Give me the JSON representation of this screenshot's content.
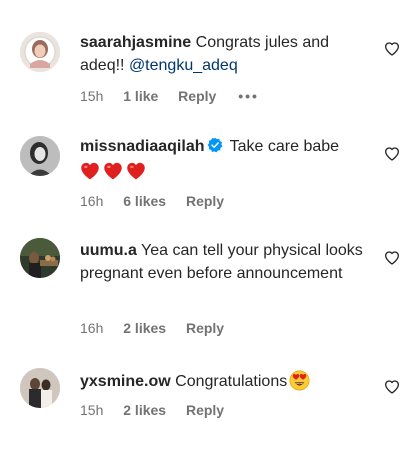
{
  "comments": [
    {
      "username": "saarahjasmine",
      "text": "Congrats jules and adeq!!",
      "mention": "@tengku_adeq",
      "time": "15h",
      "likes": "1 like",
      "reply": "Reply",
      "more": "•••"
    },
    {
      "username": "missnadiaaqilah",
      "verified": true,
      "text": "Take care babe",
      "emoji": [
        "red-heart",
        "red-heart",
        "red-heart"
      ],
      "time": "16h",
      "likes": "6 likes",
      "reply": "Reply"
    },
    {
      "username": "uumu.a",
      "text": "Yea can tell your physical looks pregnant even before announcement",
      "time": "16h",
      "likes": "2 likes",
      "reply": "Reply"
    },
    {
      "username": "yxsmine.ow",
      "text": "Congratulations",
      "emoji": [
        "heart-eyes-face"
      ],
      "time": "15h",
      "likes": "2 likes",
      "reply": "Reply"
    }
  ],
  "colors": {
    "text": "#262626",
    "meta": "#737373",
    "mention": "#00376b",
    "verified": "#0095f6",
    "heart_emoji": "#e0201f"
  }
}
